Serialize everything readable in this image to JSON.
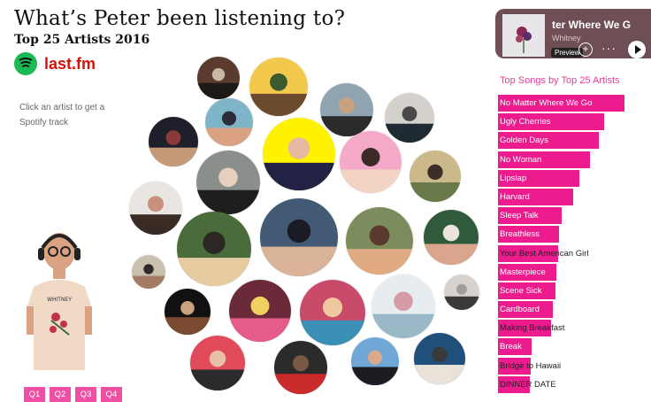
{
  "header": {
    "title": "What’s Peter been listening to?",
    "subtitle": "Top 25 Artists 2016"
  },
  "logos": {
    "spotify": "spotify-logo",
    "lastfm": "last.fm"
  },
  "hint": "Click an artist to get a Spotify track",
  "quarters": [
    "Q1",
    "Q2",
    "Q3",
    "Q4"
  ],
  "player": {
    "title": "ter Where We G",
    "artist": "Whitney",
    "badge": "Preview",
    "dots": "···",
    "plus": "+"
  },
  "songs": {
    "title": "Top Songs by Top 25 Artists",
    "items": [
      {
        "label": "No Matter Where We Go",
        "value": 143
      },
      {
        "label": "Ugly Cherries",
        "value": 120
      },
      {
        "label": "Golden Days",
        "value": 114
      },
      {
        "label": "No Woman",
        "value": 104
      },
      {
        "label": "Lipslap",
        "value": 92
      },
      {
        "label": "Harvard",
        "value": 85
      },
      {
        "label": "Sleep Talk",
        "value": 72
      },
      {
        "label": "Breathless",
        "value": 69
      },
      {
        "label": "Your Best American Girl",
        "value": 68
      },
      {
        "label": "Masterpiece",
        "value": 66
      },
      {
        "label": "Scene Sick",
        "value": 65
      },
      {
        "label": "Cardboard",
        "value": 62
      },
      {
        "label": "Making Breakfast",
        "value": 60
      },
      {
        "label": "Break",
        "value": 38
      },
      {
        "label": "Bridge to Hawaii",
        "value": 37
      },
      {
        "label": "DINNER DATE",
        "value": 36
      }
    ]
  },
  "colors": {
    "accent": "#ec1b8e",
    "spotify": "#1db954",
    "lastfm": "#d51007",
    "quarter": "#ee4fa3"
  }
}
